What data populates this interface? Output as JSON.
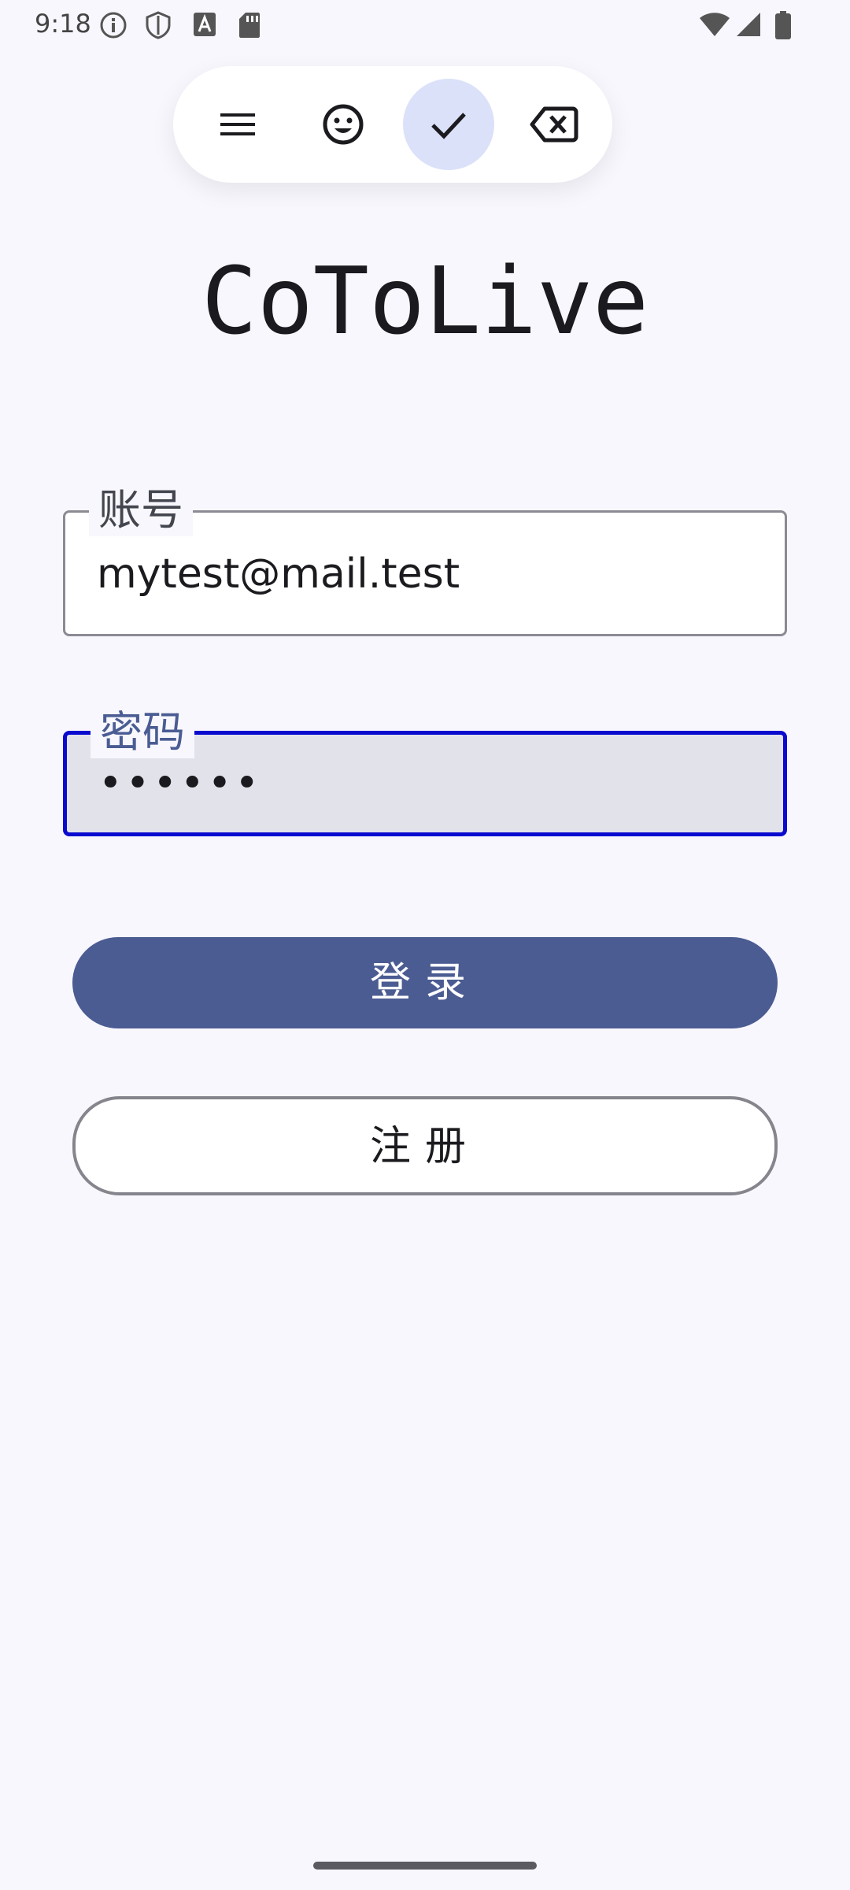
{
  "status_bar": {
    "time": "9:18",
    "icons": [
      "info-icon",
      "shield-icon",
      "font-a-icon",
      "sd-card-icon",
      "wifi-icon",
      "signal-icon",
      "battery-icon"
    ]
  },
  "toolbar": {
    "items": [
      "menu-icon",
      "emoji-icon",
      "check-icon",
      "backspace-icon"
    ],
    "active_item": "check-icon",
    "active_color": "#DCE1FA"
  },
  "app": {
    "title": "CoToLive"
  },
  "form": {
    "account_label": "账号",
    "account_value": "mytest@mail.test",
    "password_label": "密码",
    "password_value": "••••••",
    "focus_color": "#0A0ACF"
  },
  "buttons": {
    "login_label": "登录",
    "register_label": "注册",
    "primary_color": "#4B5C92"
  }
}
